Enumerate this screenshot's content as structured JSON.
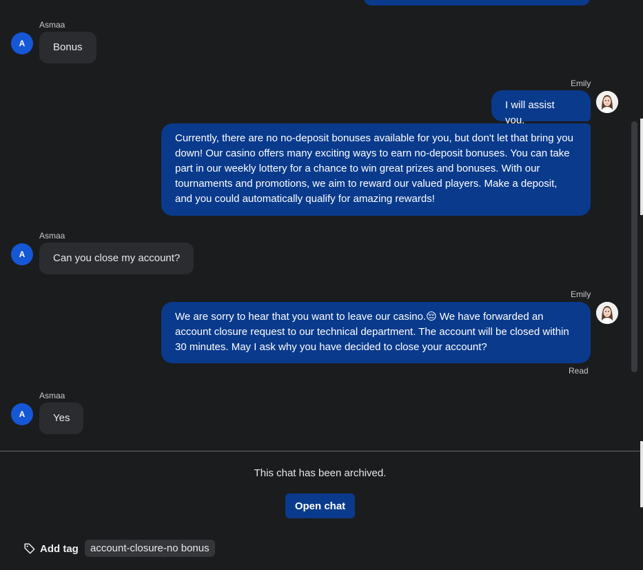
{
  "messages": {
    "m1": {
      "sender": "Asmaa",
      "avatar_initial": "A",
      "text": "Bonus"
    },
    "m2": {
      "sender": "Emily",
      "text": "I will assist you."
    },
    "m3": {
      "text": "Currently, there are no no-deposit bonuses available for you, but don't let that bring you down! Our casino offers many exciting ways to earn no-deposit bonuses. You can take part in our weekly lottery for a chance to win great prizes and bonuses. With our tournaments and promotions, we aim to reward our valued players. Make a deposit, and you could automatically qualify for amazing rewards!"
    },
    "m4": {
      "sender": "Asmaa",
      "avatar_initial": "A",
      "text": "Can you close my account?"
    },
    "m5": {
      "sender": "Emily",
      "text": "We are sorry to hear that you want to leave our casino.😔 We have forwarded an account closure request to our technical department. The account will be closed within 30 minutes. May I ask why you have decided to close your account?",
      "status": "Read"
    },
    "m6": {
      "sender": "Asmaa",
      "avatar_initial": "A",
      "text": "Yes"
    }
  },
  "footer": {
    "archived_text": "This chat has been archived.",
    "open_chat_label": "Open chat",
    "add_tag_label": "Add tag",
    "tag_icon": "tag-icon",
    "tags": [
      "account-closure-no bonus"
    ]
  },
  "colors": {
    "background": "#1b1c1e",
    "agent_bubble": "#0a3a8c",
    "visitor_bubble": "#2a2c30",
    "visitor_avatar": "#1657d6"
  }
}
